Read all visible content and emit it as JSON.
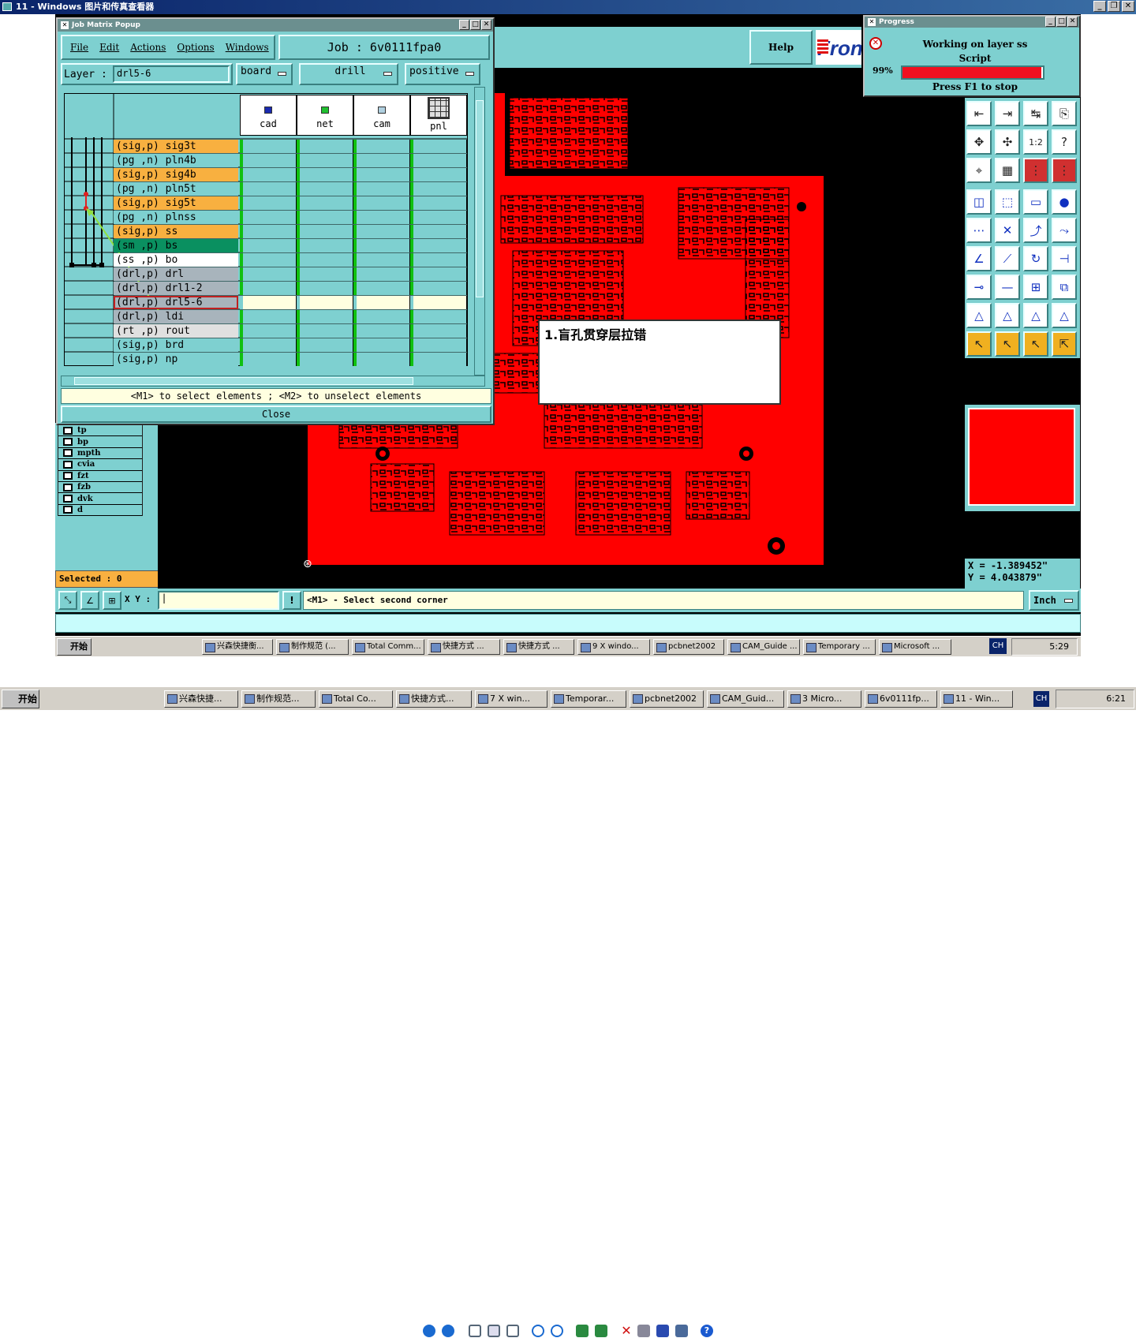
{
  "window": {
    "title": "11 - Windows 图片和传真查看器"
  },
  "jobmatrix": {
    "title": "Job Matrix Popup",
    "menu": [
      "File",
      "Edit",
      "Actions",
      "Options",
      "Windows"
    ],
    "job_label": "Job  :  6v0111fpa0",
    "layer_label": "Layer :",
    "layer_value": "drl5-6",
    "drop1": "board",
    "drop2": "drill",
    "drop3": "positive",
    "columns": [
      "cad",
      "net",
      "cam",
      "pnl"
    ],
    "rows": [
      {
        "label": "(sig,p) sig3t",
        "color": "#f8b040"
      },
      {
        "label": "(pg ,n) pln4b",
        "color": "#7ed0d0"
      },
      {
        "label": "(sig,p) sig4b",
        "color": "#f8b040"
      },
      {
        "label": "(pg ,n) pln5t",
        "color": "#7ed0d0"
      },
      {
        "label": "(sig,p) sig5t",
        "color": "#f8b040"
      },
      {
        "label": "(pg ,n) plnss",
        "color": "#7ed0d0"
      },
      {
        "label": "(sig,p) ss",
        "color": "#f8b040"
      },
      {
        "label": "(sm ,p) bs",
        "color": "#0a9060"
      },
      {
        "label": "(ss ,p) bo",
        "color": "#ffffff"
      },
      {
        "label": "(drl,p) drl",
        "color": "#a8b4bc"
      },
      {
        "label": "(drl,p) drl1-2",
        "color": "#a8b4bc"
      },
      {
        "label": "(drl,p) drl5-6",
        "color": "#a8b4bc"
      },
      {
        "label": "(drl,p) ldi",
        "color": "#a8b4bc"
      },
      {
        "label": "(rt ,p) rout",
        "color": "#e0e0e0"
      },
      {
        "label": "(sig,p) brd",
        "color": "#7ed0d0"
      },
      {
        "label": "(sig,p) np",
        "color": "#7ed0d0"
      }
    ],
    "status": "<M1> to select elements ; <M2> to unselect elements",
    "close": "Close"
  },
  "viewer": {
    "help": "Help",
    "brand": "Front",
    "annotation": "1.盲孔贯穿层拉错",
    "layers": [
      "tp",
      "bp",
      "mpth",
      "cvia",
      "fzt",
      "fzb",
      "dvk",
      "d"
    ],
    "selected": "Selected : 0",
    "xy_label": "X Y :",
    "xy_value": "|",
    "prompt": "<M1> - Select second corner",
    "units": "Inch",
    "coord_x": "X = -1.389452\"",
    "coord_y": "Y =  4.043879\""
  },
  "progress": {
    "title": "Progress",
    "line1": "Working on layer ss",
    "line2": "Script",
    "percent": "99%",
    "percent_value": 99,
    "hint": "Press F1 to stop"
  },
  "inner_taskbar": {
    "start": "开始",
    "tasks": [
      "兴森快捷衡...",
      "制作规范 (...",
      "Total Comm...",
      "快捷方式 ...",
      "快捷方式 ...",
      "9 X windo...",
      "pcbnet2002",
      "CAM_Guide ...",
      "Temporary ...",
      "Microsoft ..."
    ],
    "lang": "CH",
    "time": "5:29"
  },
  "outer_taskbar": {
    "start": "开始",
    "tasks": [
      "兴森快捷...",
      "制作规范...",
      "Total Co...",
      "快捷方式...",
      "7 X win...",
      "Temporar...",
      "pcbnet2002",
      "CAM_Guid...",
      "3 Micro...",
      "6v0111fp...",
      "11 - Win..."
    ],
    "lang": "CH",
    "time": "6:21"
  }
}
